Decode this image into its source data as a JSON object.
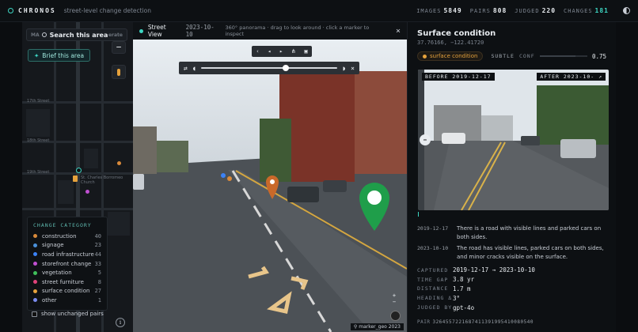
{
  "app": {
    "name": "CHRONOS",
    "tagline": "street-level change detection"
  },
  "stats": [
    {
      "label": "IMAGES",
      "value": "5849"
    },
    {
      "label": "PAIRS",
      "value": "808"
    },
    {
      "label": "JUDGED",
      "value": "220"
    },
    {
      "label": "CHANGES",
      "value": "181"
    }
  ],
  "map": {
    "search_prefix": "MA",
    "search_label": "Search this area",
    "search_suffix": "erate",
    "brief_button": "Brief this area",
    "zoom_out": "−",
    "street_labels": [
      "17th Street",
      "18th Street",
      "19th Street"
    ],
    "poi_label": "St. Charles Borromeo",
    "poi_label_2": "Church"
  },
  "legend": {
    "title": "CHANGE CATEGORY",
    "items": [
      {
        "label": "construction",
        "count": "40",
        "color": "#d98a3a"
      },
      {
        "label": "signage",
        "count": "23",
        "color": "#4a90d9"
      },
      {
        "label": "road infrastructure",
        "count": "44",
        "color": "#3b82f6"
      },
      {
        "label": "storefront change",
        "count": "33",
        "color": "#c04fd1"
      },
      {
        "label": "vegetation",
        "count": "5",
        "color": "#3fbf5a"
      },
      {
        "label": "street furniture",
        "count": "8",
        "color": "#e0427a"
      },
      {
        "label": "surface condition",
        "count": "27",
        "color": "#e6a23c"
      },
      {
        "label": "other",
        "count": "1",
        "color": "#7b8cf0"
      }
    ],
    "show_unchanged": "show unchanged pairs"
  },
  "street_view": {
    "title": "Street View",
    "date": "2023-10-10",
    "hint": "360° panorama · drag to look around · click a marker to inspect",
    "credit": "marker_geo 2023"
  },
  "panel": {
    "title": "Surface condition",
    "coords": "37.76166, −122.41720",
    "tag": "surface condition",
    "severity": "SUBTLE",
    "conf_label": "CONF",
    "confidence": 0.75,
    "conf_value": "0.75",
    "before_label": "BEFORE 2019-12-17",
    "after_label": "AFTER 2023-10-",
    "descriptions": [
      {
        "date": "2019-12-17",
        "text": "There is a road with visible lines and parked cars on both sides."
      },
      {
        "date": "2023-10-10",
        "text": "The road has visible lines, parked cars on both sides, and minor cracks visible on the surface."
      }
    ],
    "meta": [
      {
        "key": "CAPTURED",
        "value": "2019-12-17 → 2023-10-10"
      },
      {
        "key": "TIME GAP",
        "value": "3.8 yr"
      },
      {
        "key": "DISTANCE",
        "value": "1.7 m"
      },
      {
        "key": "HEADING Δ",
        "value": "3°"
      },
      {
        "key": "JUDGED BY",
        "value": "gpt-4o"
      }
    ],
    "pair_label": "PAIR",
    "pair_id": "3264557221687411391995410080540"
  },
  "colors": {
    "accent": "#3dd6c3",
    "surface": "#e6a23c"
  }
}
